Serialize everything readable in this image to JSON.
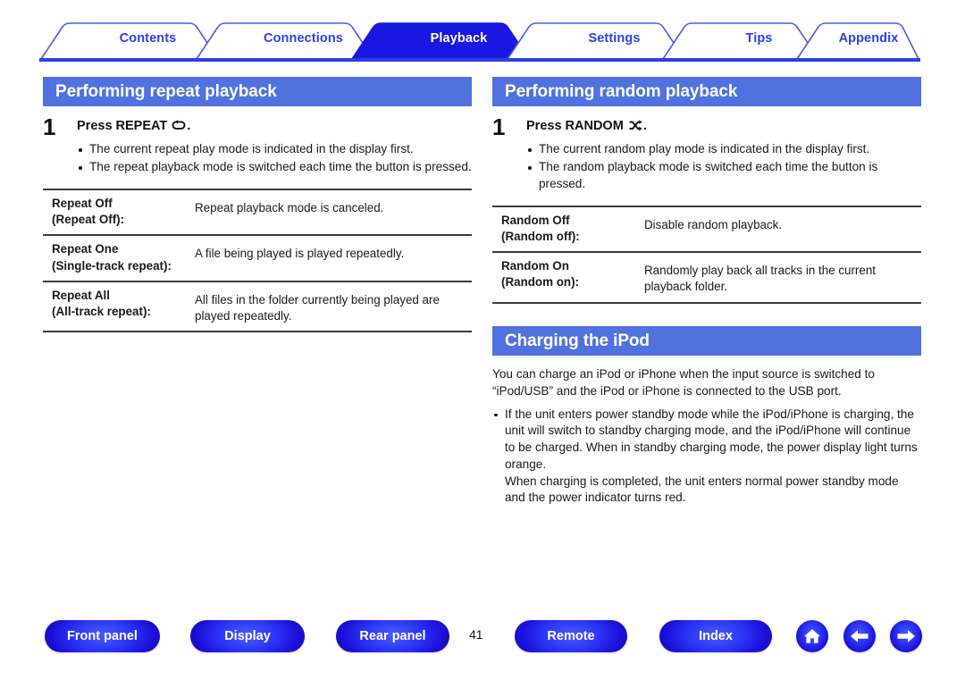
{
  "tabs": [
    {
      "label": "Contents",
      "active": false
    },
    {
      "label": "Connections",
      "active": false
    },
    {
      "label": "Playback",
      "active": true
    },
    {
      "label": "Settings",
      "active": false
    },
    {
      "label": "Tips",
      "active": false
    },
    {
      "label": "Appendix",
      "active": false
    }
  ],
  "colors": {
    "tab_active_bg": "#1A18E0",
    "tab_text": "#2B3FE8",
    "tab_border": "#4A5CE8",
    "heading_bar": "#4F72DF",
    "underline": "#2A3FE6",
    "button_blue": "#2A33F5",
    "text": "#1A1A1A"
  },
  "left_column": {
    "heading": "Performing repeat playback",
    "step": {
      "number": "1",
      "title_prefix": "Press REPEAT",
      "title_icon": "repeat-icon",
      "title_suffix": ".",
      "bullets": [
        "The current repeat play mode is indicated in the display first.",
        "The repeat playback mode is switched each time the button is pressed."
      ]
    },
    "table": {
      "rows": [
        {
          "mode": "Repeat Off",
          "mode_sub": "(Repeat Off):",
          "description": "Repeat playback mode is canceled."
        },
        {
          "mode": "Repeat One",
          "mode_sub": "(Single-track repeat):",
          "description": "A file being played is played repeatedly."
        },
        {
          "mode": "Repeat All",
          "mode_sub": "(All-track repeat):",
          "description": "All files in the folder currently being played are played repeatedly."
        }
      ]
    }
  },
  "right_column": {
    "heading": "Performing random playback",
    "step": {
      "number": "1",
      "title_prefix": "Press RANDOM",
      "title_icon": "shuffle-icon",
      "title_suffix": ".",
      "bullets": [
        "The current random play mode is indicated in the display first.",
        "The random playback mode is switched each time the button is pressed."
      ]
    },
    "table": {
      "rows": [
        {
          "mode": "Random Off",
          "mode_sub": "(Random off):",
          "description": "Disable random playback."
        },
        {
          "mode": "Random On",
          "mode_sub": "(Random on):",
          "description": "Randomly play back all tracks in the current playback folder."
        }
      ]
    },
    "charging": {
      "heading": "Charging the iPod",
      "intro": "You can charge an iPod or iPhone when the input source is switched to “iPod/USB” and the iPod or iPhone is connected to the USB port.",
      "bullet_main": "If the unit enters power standby mode while the iPod/iPhone is charging, the unit will switch to standby charging mode, and the iPod/iPhone will continue to be charged. When in standby charging mode, the power display light turns orange.",
      "bullet_cont": "When charging is completed, the unit enters normal power standby mode and the power indicator turns red."
    }
  },
  "footer": {
    "buttons": [
      {
        "label": "Front panel"
      },
      {
        "label": "Display"
      },
      {
        "label": "Rear panel"
      },
      {
        "label": "Remote"
      },
      {
        "label": "Index"
      }
    ],
    "page_number": "41",
    "icons": [
      {
        "name": "home-icon"
      },
      {
        "name": "arrow-left-icon"
      },
      {
        "name": "arrow-right-icon"
      }
    ]
  }
}
